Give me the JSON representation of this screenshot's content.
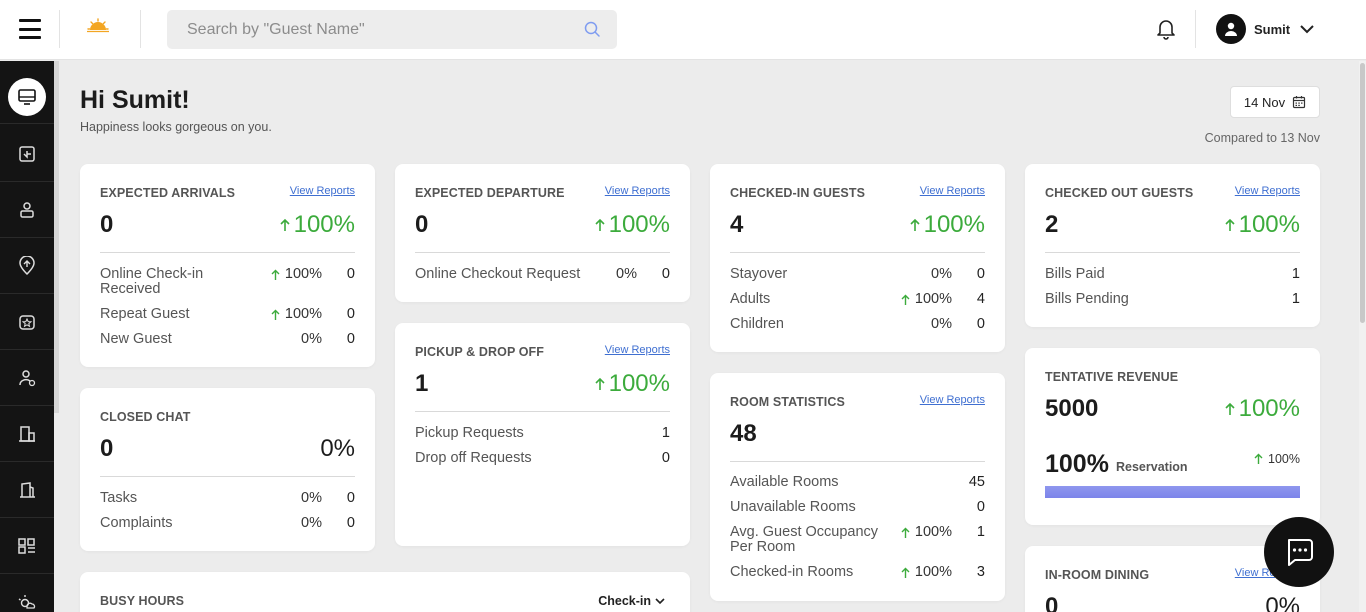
{
  "header": {
    "search_placeholder": "Search by \"Guest Name\"",
    "user_name": "Sumit"
  },
  "greeting": {
    "title": "Hi Sumit!",
    "subtitle": "Happiness looks gorgeous on you.",
    "date": "14 Nov",
    "compared": "Compared to 13 Nov"
  },
  "view_reports": "View Reports",
  "expected_arrivals": {
    "title": "EXPECTED ARRIVALS",
    "value": "0",
    "change": "100%",
    "rows": [
      {
        "label": "Online Check-in Received",
        "pct": "100%",
        "num": "0"
      },
      {
        "label": "Repeat Guest",
        "pct": "100%",
        "num": "0"
      },
      {
        "label": "New Guest",
        "pct": "0%",
        "num": "0"
      }
    ]
  },
  "expected_departure": {
    "title": "EXPECTED DEPARTURE",
    "value": "0",
    "change": "100%",
    "rows": [
      {
        "label": "Online Checkout Request",
        "pct": "0%",
        "num": "0"
      }
    ]
  },
  "checked_in": {
    "title": "CHECKED-IN GUESTS",
    "value": "4",
    "change": "100%",
    "rows": [
      {
        "label": "Stayover",
        "pct": "0%",
        "num": "0"
      },
      {
        "label": "Adults",
        "pct": "100%",
        "num": "4"
      },
      {
        "label": "Children",
        "pct": "0%",
        "num": "0"
      }
    ]
  },
  "checked_out": {
    "title": "CHECKED OUT GUESTS",
    "value": "2",
    "change": "100%",
    "rows": [
      {
        "label": "Bills Paid",
        "num": "1"
      },
      {
        "label": "Bills Pending",
        "num": "1"
      }
    ]
  },
  "closed_chat": {
    "title": "CLOSED CHAT",
    "value": "0",
    "change": "0%",
    "rows": [
      {
        "label": "Tasks",
        "pct": "0%",
        "num": "0"
      },
      {
        "label": "Complaints",
        "pct": "0%",
        "num": "0"
      }
    ]
  },
  "pickup": {
    "title": "PICKUP & DROP OFF",
    "value": "1",
    "change": "100%",
    "rows": [
      {
        "label": "Pickup Requests",
        "num": "1"
      },
      {
        "label": "Drop off Requests",
        "num": "0"
      }
    ]
  },
  "room_stats": {
    "title": "ROOM STATISTICS",
    "value": "48",
    "rows": [
      {
        "label": "Available Rooms",
        "num": "45"
      },
      {
        "label": "Unavailable Rooms",
        "num": "0"
      },
      {
        "label": "Avg. Guest Occupancy Per Room",
        "pct": "100%",
        "num": "1"
      },
      {
        "label": "Checked-in Rooms",
        "pct": "100%",
        "num": "3"
      }
    ]
  },
  "revenue": {
    "title": "TENTATIVE REVENUE",
    "value": "5000",
    "change": "100%",
    "reservation_pct": "100%",
    "reservation_label": "Reservation",
    "reservation_change": "100%",
    "progress": 1.0
  },
  "in_room_dining": {
    "title": "IN-ROOM DINING",
    "value": "0",
    "change": "0%"
  },
  "busy_hours": {
    "title": "BUSY HOURS",
    "selected": "Check-in"
  },
  "colors": {
    "accent_green": "#3cab3c",
    "link_blue": "#3f6fd1",
    "progress_purple": "#7c84ea",
    "sidebar": "#141414"
  },
  "sidebar_icons": [
    "dashboard-icon",
    "checkin-icon",
    "guest-icon",
    "location-icon",
    "service-icon",
    "staff-icon",
    "building-icon",
    "property-icon",
    "apps-icon",
    "weather-icon"
  ]
}
